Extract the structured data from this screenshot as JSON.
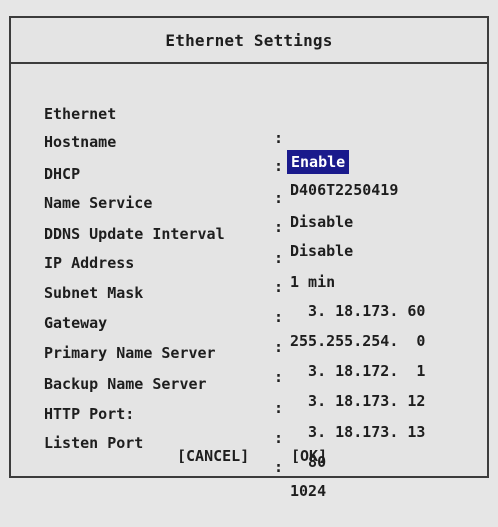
{
  "dialog": {
    "title": "Ethernet Settings",
    "highlight_color": "#1a1a8c",
    "rows": [
      {
        "label": "Ethernet",
        "colon": ":",
        "value": "Enable"
      },
      {
        "label": "Hostname",
        "colon": ":",
        "value": "D406T2250419"
      },
      {
        "label": "DHCP",
        "colon": ":",
        "value": "Disable"
      },
      {
        "label": "Name Service",
        "colon": ":",
        "value": "Disable"
      },
      {
        "label": "DDNS Update Interval",
        "colon": ":",
        "value": "1 min"
      },
      {
        "label": "IP Address",
        "colon": ":",
        "value": "  3. 18.173. 60"
      },
      {
        "label": "Subnet Mask",
        "colon": ":",
        "value": "255.255.254.  0"
      },
      {
        "label": "Gateway",
        "colon": ":",
        "value": "  3. 18.172.  1"
      },
      {
        "label": "Primary Name Server",
        "colon": ":",
        "value": "  3. 18.173. 12"
      },
      {
        "label": "Backup Name Server",
        "colon": ":",
        "value": "  3. 18.173. 13"
      },
      {
        "label": "HTTP Port:",
        "colon": ":",
        "value": "  80"
      },
      {
        "label": "Listen Port",
        "colon": ":",
        "value": "1024"
      }
    ],
    "buttons": {
      "cancel": "[CANCEL]",
      "ok": "[OK]"
    }
  }
}
